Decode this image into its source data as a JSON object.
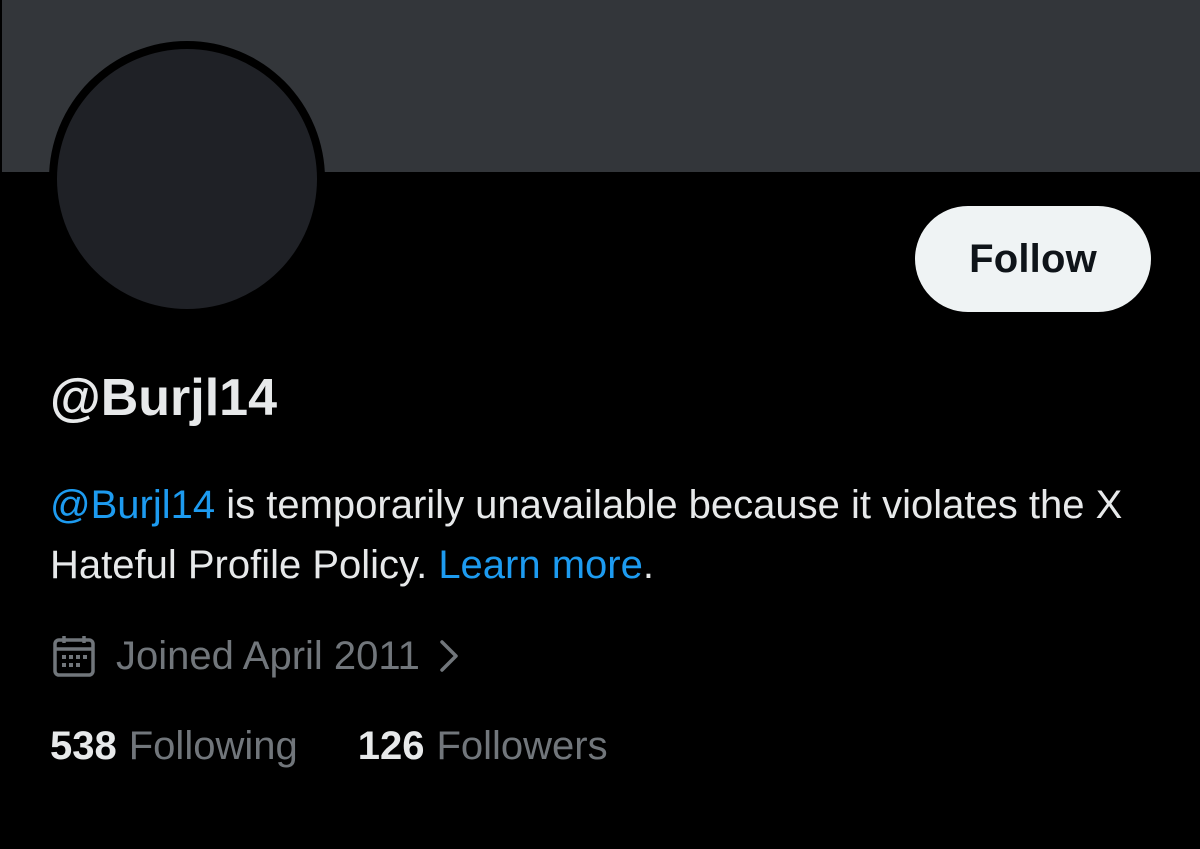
{
  "profile": {
    "follow_label": "Follow",
    "handle": "@Burjl14"
  },
  "notice": {
    "mention": "@Burjl14",
    "text_before_link": " is temporarily unavailable because it violates the X Hateful Profile Policy. ",
    "learn_more": "Learn more",
    "text_after_link": "."
  },
  "joined": {
    "icon": "calendar-icon",
    "label": "Joined April 2011",
    "chevron": "chevron-right-icon"
  },
  "stats": {
    "following_count": "538",
    "following_label": "Following",
    "followers_count": "126",
    "followers_label": "Followers"
  },
  "colors": {
    "background": "#000000",
    "banner": "#33363a",
    "avatar": "#1f2126",
    "follow_button_bg": "#eff3f4",
    "primary_text": "#e7e9ea",
    "secondary_text": "#71767b",
    "link": "#1d9bf0"
  }
}
